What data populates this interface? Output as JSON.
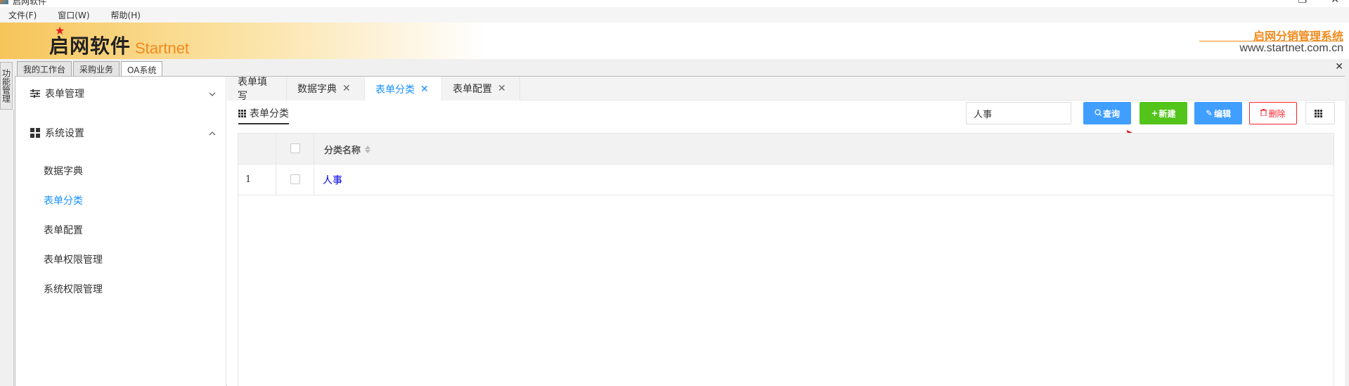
{
  "window": {
    "title": "启网软件"
  },
  "menu": {
    "items": [
      "文件(F)",
      "窗口(W)",
      "帮助(H)"
    ]
  },
  "banner": {
    "logo_cn": "启网软件",
    "logo_en": "Startnet",
    "system_name": "启网分销管理系统",
    "url": "www.startnet.com.cn"
  },
  "side_tab": {
    "label": "功能管理"
  },
  "workspace_tabs": [
    "我的工作台",
    "采购业务",
    "OA系统"
  ],
  "sidebar": {
    "groups": [
      {
        "label": "表单管理",
        "icon": "sliders-icon",
        "expanded": false
      },
      {
        "label": "系统设置",
        "icon": "apps-grid-icon",
        "expanded": true
      }
    ],
    "items": [
      "数据字典",
      "表单分类",
      "表单配置",
      "表单权限管理",
      "系统权限管理"
    ],
    "active_item": "表单分类"
  },
  "page_tabs": [
    {
      "label": "表单填写",
      "closable": false
    },
    {
      "label": "数据字典",
      "closable": true
    },
    {
      "label": "表单分类",
      "closable": true,
      "active": true
    },
    {
      "label": "表单配置",
      "closable": true
    }
  ],
  "panel": {
    "title": "表单分类"
  },
  "toolbar": {
    "search_value": "人事",
    "query_label": "查询",
    "new_label": "新建",
    "edit_label": "编辑",
    "delete_label": "删除"
  },
  "table": {
    "columns": [
      "分类名称"
    ],
    "rows": [
      {
        "index": "1",
        "name": "人事"
      }
    ]
  },
  "colors": {
    "accent_blue": "#409eff",
    "success_green": "#52c41a",
    "danger_red": "#f5222d",
    "brand_orange": "#f08a1c",
    "link": "#0000ee"
  }
}
